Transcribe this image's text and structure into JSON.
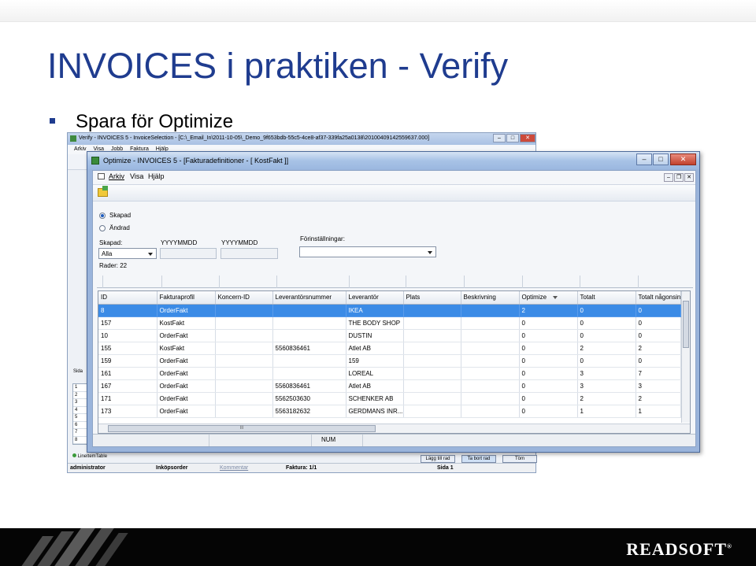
{
  "slide": {
    "title": "INVOICES i praktiken - Verify",
    "bullet": "Spara för Optimize"
  },
  "back_window": {
    "title": "Verify - INVOICES 5 - InvoiceSelection - [C:\\_Email_In\\2011-10-05\\_Demo_9f653bdb-55c5-4ce8-af37-339fa25a0138\\20100409142559637.000]",
    "menu": [
      "Arkiv",
      "Visa",
      "Jobb",
      "Faktura",
      "Hjälp"
    ],
    "side_label": "Sida",
    "row_numbers": [
      "1",
      "2",
      "3",
      "4",
      "5",
      "6",
      "7",
      "8"
    ],
    "tab_label": "LineItemTable",
    "buttons": [
      "Lägg till rad",
      "Ta bort rad",
      "Töm"
    ],
    "status": {
      "user": "administrator",
      "profile": "Inköpsorder",
      "comment_link": "Kommentar",
      "invoice": "Faktura: 1/1",
      "page": "Sida 1"
    }
  },
  "window": {
    "title": "Optimize - INVOICES 5 - [Fakturadefinitioner - [ KostFakt ]]",
    "menu": [
      "Arkiv",
      "Visa",
      "Hjälp"
    ],
    "controls": {
      "minimize": "–",
      "maximize": "□",
      "close": "✕"
    },
    "mdi_controls": {
      "minimize": "–",
      "restore": "❐",
      "close": "✕"
    }
  },
  "filters": {
    "radio_created": "Skapad",
    "radio_changed": "Ändrad",
    "created_label": "Skapad:",
    "created_value": "Alla",
    "from_label": "YYYYMMDD",
    "to_label": "YYYYMMDD",
    "presets_label": "Förinställningar:",
    "rows_label": "Rader: 22"
  },
  "grid": {
    "columns": [
      "ID",
      "Fakturaprofil",
      "Koncern-ID",
      "Leverantörsnummer",
      "Leverantör",
      "Plats",
      "Beskrivning",
      "Optimize",
      "Totalt",
      "Totalt någonsin"
    ],
    "rows": [
      [
        "8",
        "OrderFakt",
        "",
        "",
        "IKEA",
        "",
        "",
        "2",
        "0",
        "0"
      ],
      [
        "157",
        "KostFakt",
        "",
        "",
        "THE BODY SHOP",
        "",
        "",
        "0",
        "0",
        "0"
      ],
      [
        "10",
        "OrderFakt",
        "",
        "",
        "DUSTIN",
        "",
        "",
        "0",
        "0",
        "0"
      ],
      [
        "155",
        "KostFakt",
        "",
        "5560836461",
        "Atlet AB",
        "",
        "",
        "0",
        "2",
        "2"
      ],
      [
        "159",
        "OrderFakt",
        "",
        "",
        "159",
        "",
        "",
        "0",
        "0",
        "0"
      ],
      [
        "161",
        "OrderFakt",
        "",
        "",
        "LOREAL",
        "",
        "",
        "0",
        "3",
        "7"
      ],
      [
        "167",
        "OrderFakt",
        "",
        "5560836461",
        "Atlet AB",
        "",
        "",
        "0",
        "3",
        "3"
      ],
      [
        "171",
        "OrderFakt",
        "",
        "5562503630",
        "SCHENKER AB",
        "",
        "",
        "0",
        "2",
        "2"
      ],
      [
        "173",
        "OrderFakt",
        "",
        "5563182632",
        "GERDMANS INR...",
        "",
        "",
        "0",
        "1",
        "1"
      ]
    ],
    "scroll_grip": "III"
  },
  "statusbar": {
    "num": "NUM"
  },
  "brand": {
    "logo": "READSOFT",
    "mark": "®"
  },
  "colors": {
    "title_blue": "#1f3c8f",
    "selection": "#3b8be6"
  }
}
